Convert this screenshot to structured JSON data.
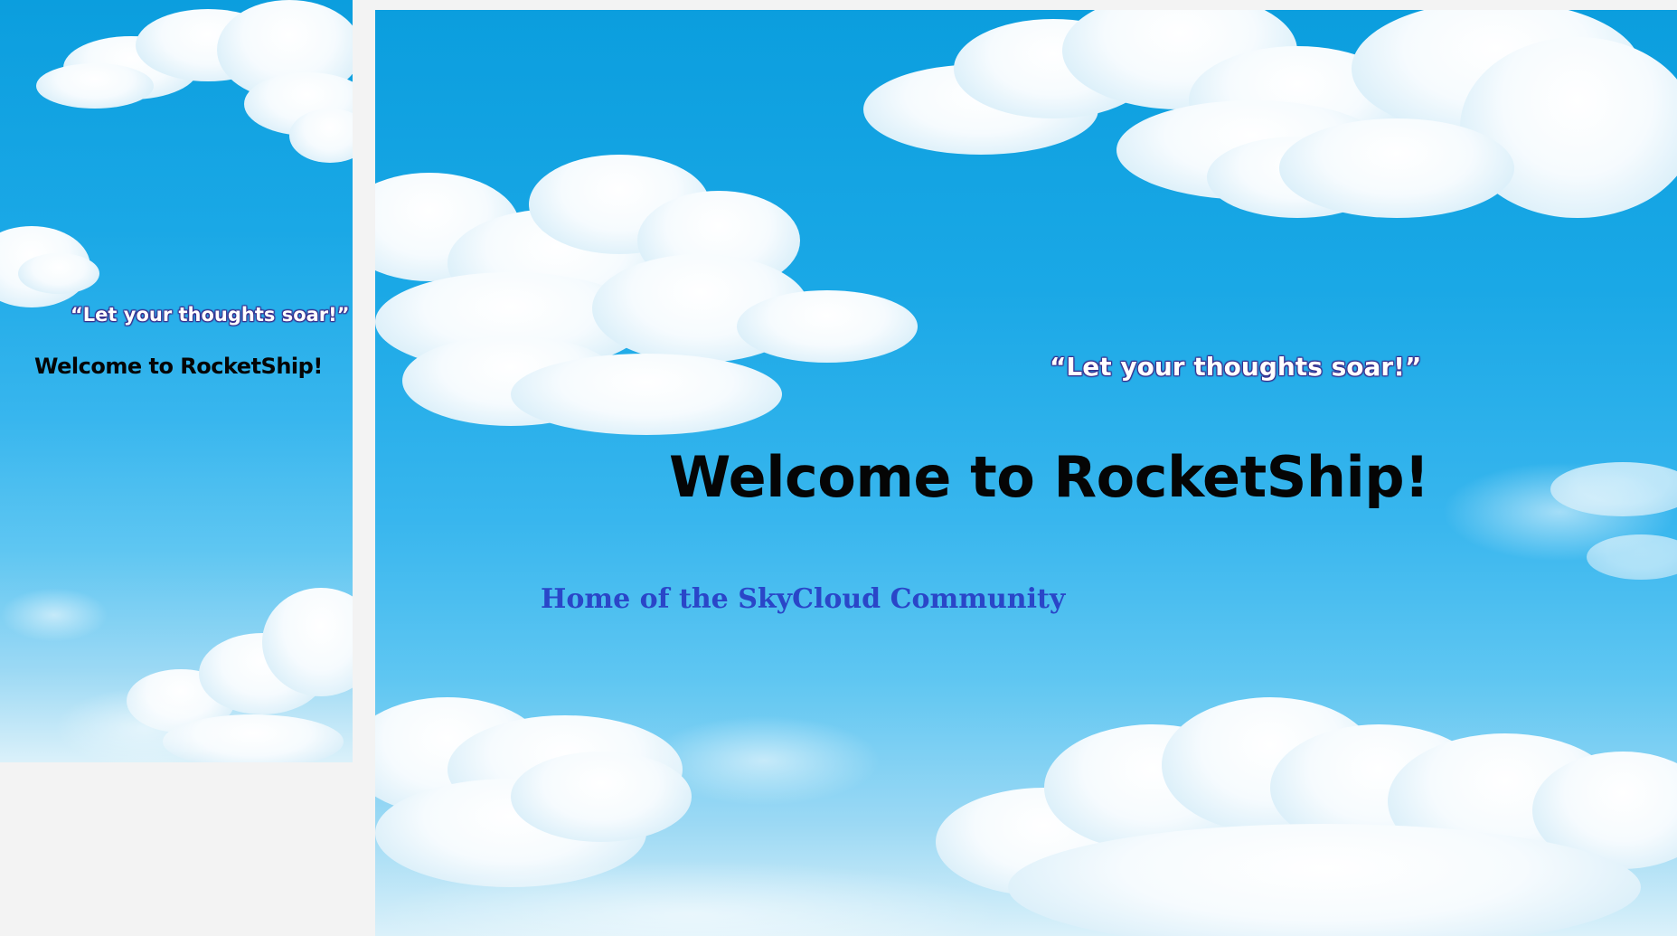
{
  "viewport_small": {
    "tagline": "“Let your thoughts soar!”",
    "welcome": "Welcome to RocketShip!"
  },
  "viewport_large": {
    "tagline": "“Let your thoughts soar!”",
    "welcome": "Welcome to RocketShip!",
    "subtitle": "Home of the SkyCloud Community"
  },
  "colors": {
    "sky": "#1aa8e6",
    "tagline_text": "#ffffff",
    "welcome_text": "#050505",
    "subtitle_text": "#2a46c8",
    "page_background": "#f3f3f3"
  },
  "images": {
    "background": "sky-with-clouds"
  }
}
